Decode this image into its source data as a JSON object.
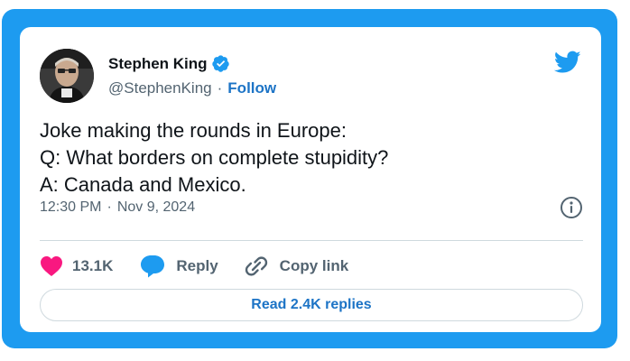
{
  "author": {
    "display_name": "Stephen King",
    "handle": "@StephenKing",
    "separator": "·",
    "follow_label": "Follow",
    "verified": true
  },
  "tweet": {
    "lines": [
      "Joke making the rounds in Europe:",
      "Q: What borders on complete stupidity?",
      "A: Canada and Mexico."
    ],
    "time": "12:30 PM",
    "date_separator": "·",
    "date": "Nov 9, 2024"
  },
  "actions": {
    "like_count": "13.1K",
    "reply_label": "Reply",
    "copy_link_label": "Copy link",
    "read_replies_label": "Read 2.4K replies"
  },
  "colors": {
    "frame": "#1d9bf0",
    "link": "#1d74c6",
    "like": "#f91880",
    "reply": "#1d9bf0",
    "muted": "#536471"
  },
  "icons": {
    "brand": "twitter-bird-icon",
    "verified": "verified-badge-icon",
    "info": "info-icon",
    "like": "heart-icon",
    "reply": "speech-bubble-icon",
    "copy": "link-icon"
  }
}
